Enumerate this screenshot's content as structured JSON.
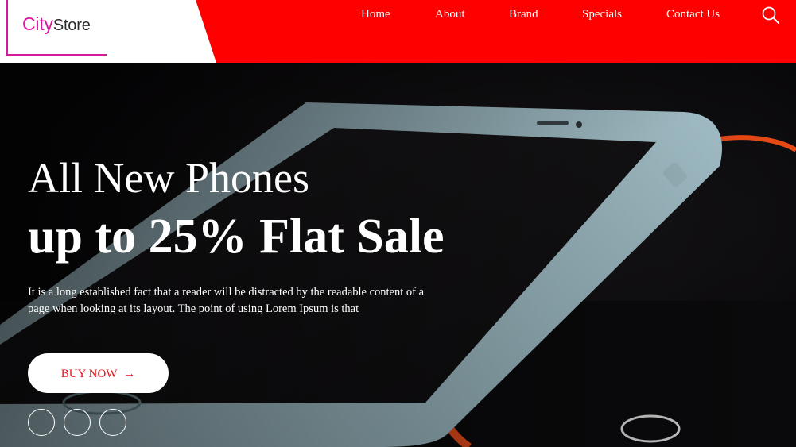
{
  "logo": {
    "part1": "City",
    "part2": "Store"
  },
  "nav": {
    "items": [
      {
        "label": "Home"
      },
      {
        "label": "About"
      },
      {
        "label": "Brand"
      },
      {
        "label": "Specials"
      },
      {
        "label": "Contact Us"
      }
    ],
    "search_icon": "search-icon"
  },
  "hero": {
    "title": "All New Phones",
    "subtitle": "up to 25% Flat Sale",
    "text": "It is a long established fact that a reader will be distracted by the readable content of a page when looking at its layout. The point of using Lorem Ipsum is that",
    "button_label": "BUY NOW",
    "button_arrow": "→",
    "carousel_slides": 3
  },
  "colors": {
    "header_bg": "#ff0000",
    "logo_accent": "#d6189a",
    "button_text": "#e5151b",
    "hero_bg": "#0b0a0c",
    "phone_frame": "#a9c6cf"
  }
}
